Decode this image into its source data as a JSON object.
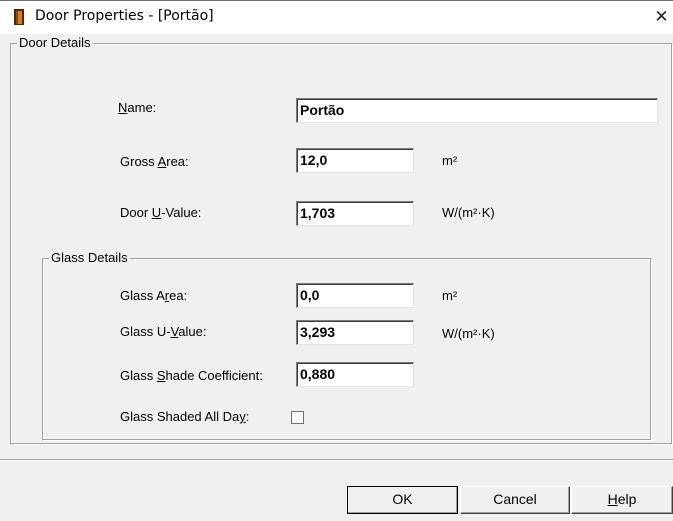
{
  "window": {
    "title": "Door Properties - [Portão]",
    "close_glyph": "✕"
  },
  "door_details": {
    "legend": "Door Details",
    "name": {
      "label_pre": "",
      "label_mnemonic": "N",
      "label_post": "ame:",
      "value": "Portão"
    },
    "gross_area": {
      "label_pre": "Gross ",
      "label_mnemonic": "A",
      "label_post": "rea:",
      "value": "12,0",
      "unit": "m²"
    },
    "door_u_value": {
      "label_pre": "Door ",
      "label_mnemonic": "U",
      "label_post": "-Value:",
      "value": "1,703",
      "unit": "W/(m²·K)"
    }
  },
  "glass_details": {
    "legend": "Glass Details",
    "glass_area": {
      "label_pre": "Glass A",
      "label_mnemonic": "r",
      "label_post": "ea:",
      "value": "0,0",
      "unit": "m²"
    },
    "glass_u_value": {
      "label_pre": "Glass U-",
      "label_mnemonic": "V",
      "label_post": "alue:",
      "value": "3,293",
      "unit": "W/(m²·K)"
    },
    "glass_shade": {
      "label_pre": "Glass ",
      "label_mnemonic": "S",
      "label_post": "hade Coefficient:",
      "value": "0,880"
    },
    "glass_shaded_all_day": {
      "label_pre": "Glass Shaded All Da",
      "label_mnemonic": "y",
      "label_post": ":",
      "checked": false
    }
  },
  "buttons": {
    "ok": "OK",
    "cancel": "Cancel",
    "help_mnemonic": "H",
    "help_post": "elp"
  },
  "colors": {
    "dialog_bg": "#f0f0f0",
    "title_bg": "#ffffff",
    "door_icon_dark": "#4a2a0a",
    "door_icon_accent": "#e07a10"
  },
  "icons": {
    "title": "door-icon",
    "close": "close-icon"
  }
}
